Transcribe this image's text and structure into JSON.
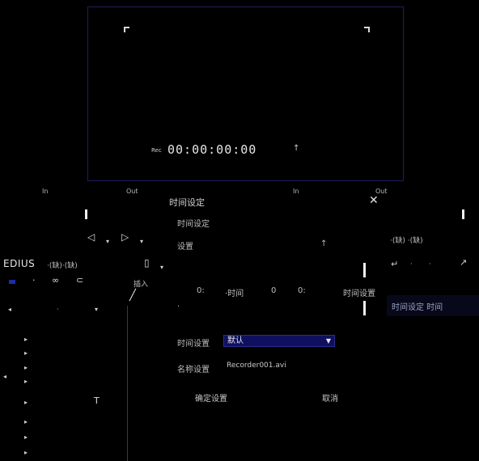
{
  "app": {
    "brand": "EDIUS",
    "menu_tail": "·(缺)·(缺)"
  },
  "monitor": {
    "timecode_prefix": "Rec",
    "timecode": "00:00:00:00",
    "timecode_end": "↑"
  },
  "ruler": {
    "labels": [
      "In",
      "Out",
      "In",
      "Out"
    ]
  },
  "dialog": {
    "title": "时间设定",
    "close_glyph": "✕",
    "row1_label": "时间设定",
    "row2_label": "设置",
    "row2_value": "↑",
    "middle_labels": [
      "0:",
      "·时间",
      "0",
      "0:",
      "时间设置"
    ],
    "small_mark": "·",
    "field_label": "时间设置",
    "select_value": "默认",
    "select_caret": "▼",
    "name_label": "名称设置",
    "name_value": "Recorder001.avi",
    "ok_label": "确定设置",
    "cancel_label": "取消"
  },
  "right_panel": {
    "row1": "·(缺) ·(缺)",
    "row2_glyphs": [
      "↵",
      "·",
      "·",
      "↗"
    ],
    "status_text": "时间设定 时间"
  },
  "left_panel": {
    "tool_glyphs": [
      "·",
      "∞",
      "⊂"
    ],
    "insert_label": "插入",
    "insert_icon": "╱",
    "header_glyph_left": "◂",
    "header_glyph_mid": "·",
    "header_glyph_right": "▾",
    "row_arrows": [
      "▸",
      "▸",
      "▸",
      "▸",
      "▸",
      "▸",
      "▸",
      "▸"
    ],
    "track_glyph": "T",
    "marker": "◂"
  },
  "transport": {
    "prev_glyph": "◁",
    "play_glyph": "▷",
    "doc_glyph": "▯"
  },
  "icons": [
    "close-icon",
    "play-icon",
    "prev-icon",
    "document-icon",
    "loop-icon",
    "caret-down-icon",
    "insert-icon"
  ],
  "colors": {
    "select_bg": "#0f1060",
    "accent_blue": "#1c2ea0",
    "monitor_border": "#1d1f5a"
  }
}
